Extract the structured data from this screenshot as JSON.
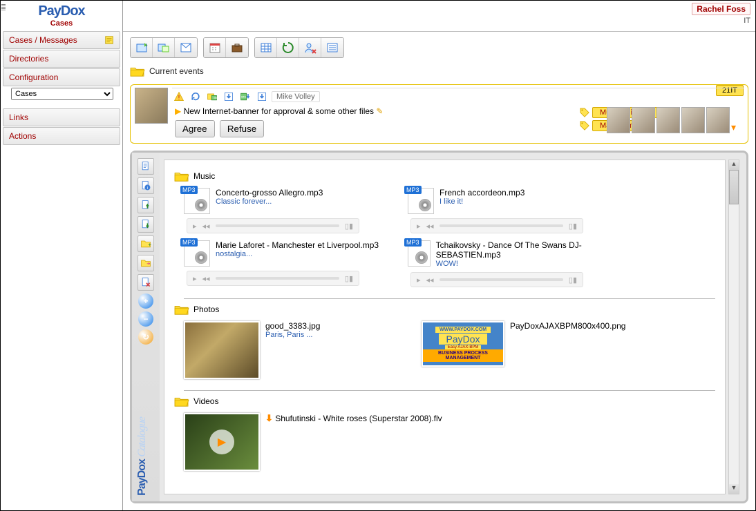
{
  "branding": {
    "logo": "PayDox",
    "module": "Cases",
    "catalogue_label": "Catalogue"
  },
  "user": {
    "name": "Rachel Foss",
    "role": "IT"
  },
  "sidebar": {
    "items": [
      {
        "label": "Cases / Messages"
      },
      {
        "label": "Directories"
      },
      {
        "label": "Configuration"
      }
    ],
    "dropdown_value": "Cases",
    "links_label": "Links",
    "actions_label": "Actions"
  },
  "toolbar": {
    "groups": [
      [
        "new-case-icon",
        "new-subcase-icon",
        "new-message-icon"
      ],
      [
        "calendar-icon",
        "briefcase-icon"
      ],
      [
        "grid-icon",
        "recycle-icon",
        "user-remove-icon",
        "list-icon"
      ]
    ]
  },
  "breadcrumb": {
    "label": "Current events"
  },
  "case": {
    "author": "Mike Volley",
    "subject": "New Internet-banner for approval & some other files",
    "icons": [
      "alert-icon",
      "refresh-icon",
      "folder-img-icon",
      "download-icon",
      "img-download-icon",
      "download2-icon"
    ],
    "code": "21IT",
    "buttons": {
      "agree": "Agree",
      "refuse": "Refuse"
    },
    "tags": [
      "Multimedia, etc.",
      "Management"
    ],
    "participants_count": 5
  },
  "catalogue": {
    "side_buttons": [
      "doc-icon",
      "doc-info-icon",
      "doc-up-icon",
      "doc-down-icon",
      "folder-add-icon",
      "folder-move-icon",
      "doc-delete-icon"
    ],
    "circle_buttons": [
      {
        "sym": "+",
        "color": "#2080e8"
      },
      {
        "sym": "−",
        "color": "#2080e8"
      },
      {
        "sym": "↻",
        "color": "#f0a020"
      }
    ],
    "sections": [
      {
        "title": "Music",
        "type": "audio",
        "items": [
          {
            "title": "Concerto-grosso Allegro.mp3",
            "caption": "Classic forever..."
          },
          {
            "title": "French accordeon.mp3",
            "caption": "I like it!"
          },
          {
            "title": "Marie Laforet - Manchester et Liverpool.mp3",
            "caption": "nostalgia..."
          },
          {
            "title": "Tchaikovsky - Dance Of The Swans DJ-SEBASTIEN.mp3",
            "caption": "WOW!"
          }
        ]
      },
      {
        "title": "Photos",
        "type": "image",
        "items": [
          {
            "title": "good_3383.jpg",
            "caption": "Paris, Paris ...",
            "kind": "photo"
          },
          {
            "title": "PayDoxAJAXBPM800x400.png",
            "caption": "",
            "kind": "banner",
            "banner": {
              "url": "WWW.PAYDOX.COM",
              "brand": "PayDox",
              "sub": "Easy AJAX-BPM",
              "strip": "BUSINESS PROCESS MANAGEMENT"
            }
          }
        ]
      },
      {
        "title": "Videos",
        "type": "video",
        "items": [
          {
            "title": "Shufutinski - White roses (Superstar 2008).flv"
          }
        ]
      }
    ]
  }
}
